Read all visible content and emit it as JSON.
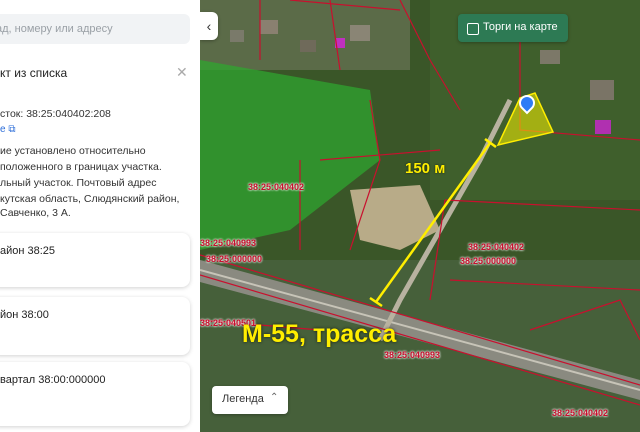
{
  "panel": {
    "search_placeholder": "ад, номеру или адресу",
    "title": "кт из списка",
    "parcel_line": "сток: 38:25:040402:208",
    "copy_label": "е ⧉",
    "description": [
      "ие установлено относительно",
      "положенного в границах участка.",
      "льный участок. Почтовый адрес",
      "кутская область, Слюдянский район,",
      "Савченко, 3 А."
    ],
    "cards": [
      {
        "label": "айон 38:25"
      },
      {
        "label": "йон 38:00"
      },
      {
        "label": "вартал 38:00:000000"
      }
    ]
  },
  "map": {
    "torgi_label": "Торги на карте",
    "legend_label": "Легенда",
    "distance_label": "150 м",
    "road_label": "М-55, трасса",
    "parcels": [
      {
        "label": "38:25:040402"
      },
      {
        "label": "38:25:040993"
      },
      {
        "label": "38:25:000000"
      },
      {
        "label": "38:25:040402"
      },
      {
        "label": "38:25:000000"
      },
      {
        "label": "38:25:040501"
      },
      {
        "label": "38:25:040993"
      },
      {
        "label": "38:25:040402"
      }
    ],
    "colors": {
      "parcel_line": "#c8102e",
      "measure": "#ffee00",
      "button": "#2d7a54",
      "pin": "#2f7cf6"
    }
  }
}
